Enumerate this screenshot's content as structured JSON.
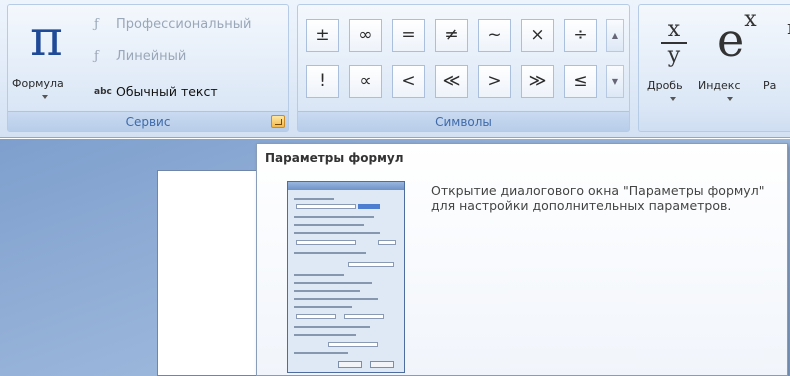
{
  "ribbon": {
    "service": {
      "label": "Сервис",
      "formula_button": {
        "symbol": "π",
        "label": "Формула"
      },
      "professional": {
        "icon": "ƒ",
        "label": "Профессиональный"
      },
      "linear": {
        "icon": "ƒ",
        "label": "Линейный"
      },
      "plain_text": {
        "icon": "abc",
        "label": "Обычный текст"
      }
    },
    "symbols": {
      "label": "Символы",
      "row1": [
        "±",
        "∞",
        "=",
        "≠",
        "~",
        "×",
        "÷"
      ],
      "row2": [
        "!",
        "∝",
        "<",
        "≪",
        ">",
        "≫",
        "≤"
      ]
    },
    "structures": {
      "fraction": {
        "num": "x",
        "den": "y",
        "label": "Дробь"
      },
      "index": {
        "base": "e",
        "exp": "x",
        "label": "Индекс"
      },
      "radical": {
        "symbol": "n",
        "label": "Ра"
      }
    }
  },
  "tooltip": {
    "title": "Параметры формул",
    "description": "Открытие диалогового окна \"Параметры формул\" для настройки дополнительных параметров."
  },
  "colors": {
    "accent": "#15428b",
    "ribbon_bg": "#dbe7f6",
    "doc_bg": "#9bb6db"
  }
}
